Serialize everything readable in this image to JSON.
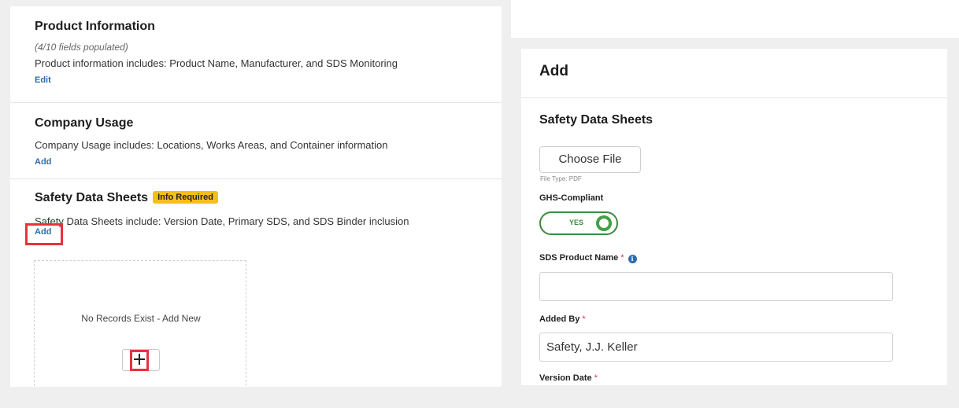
{
  "left": {
    "product_information": {
      "title": "Product Information",
      "subtitle": "(4/10 fields populated)",
      "description": "Product information includes: Product Name, Manufacturer, and SDS Monitoring",
      "link": "Edit"
    },
    "company_usage": {
      "title": "Company Usage",
      "description": "Company Usage includes: Locations, Works Areas, and Container information",
      "link": "Add"
    },
    "safety_data_sheets": {
      "title": "Safety Data Sheets",
      "badge": "Info Required",
      "description": "Safety Data Sheets include: Version Date, Primary SDS, and SDS Binder inclusion",
      "link": "Add"
    },
    "records": {
      "empty_text": "No Records Exist - Add New"
    }
  },
  "form": {
    "title": "Add",
    "subtitle": "Safety Data Sheets",
    "choose_file_label": "Choose File",
    "file_type": "File Type: PDF",
    "ghs_label": "GHS-Compliant",
    "ghs_toggle_label": "YES",
    "sds_product_name_label": "SDS Product Name",
    "sds_product_name_value": "",
    "added_by_label": "Added By",
    "added_by_value": "Safety, J.J. Keller",
    "version_date_label": "Version Date",
    "required_mark": "*",
    "info_glyph": "i"
  },
  "colors": {
    "link": "#2a6db0",
    "badge": "#f7be17",
    "highlight": "#e8323c",
    "toggle_green": "#43a047",
    "background": "#efefef"
  }
}
